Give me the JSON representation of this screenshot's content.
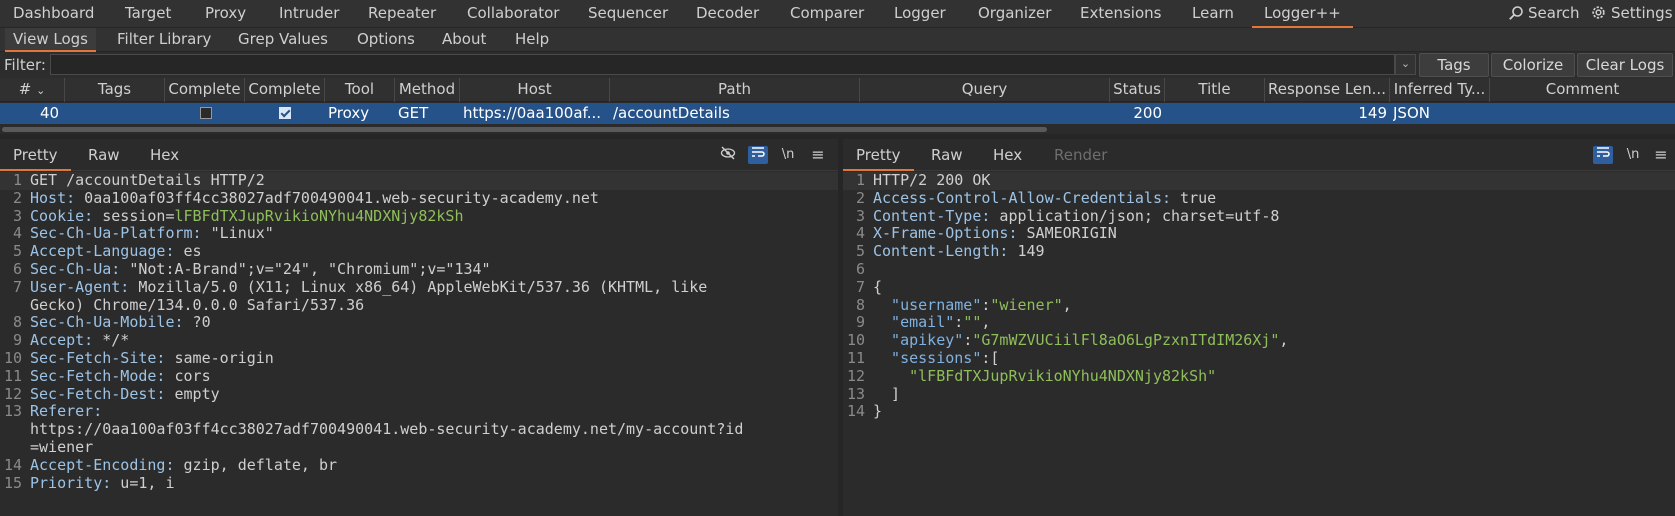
{
  "menu": {
    "tabs": [
      "Dashboard",
      "Target",
      "Proxy",
      "Intruder",
      "Repeater",
      "Collaborator",
      "Sequencer",
      "Decoder",
      "Comparer",
      "Logger",
      "Organizer",
      "Extensions",
      "Learn",
      "Logger++"
    ],
    "search_label": "Search",
    "settings_label": "Settings"
  },
  "subtabs": [
    "View Logs",
    "Filter Library",
    "Grep Values",
    "Options",
    "About",
    "Help"
  ],
  "filter": {
    "label": "Filter:",
    "value": "",
    "tags_button": "Tags",
    "colorize_button": "Colorize",
    "clear_button": "Clear Logs"
  },
  "table": {
    "headers": [
      "#",
      "Tags",
      "Complete",
      "Complete",
      "Tool",
      "Method",
      "Host",
      "Path",
      "Query",
      "Status",
      "Title",
      "Response Len...",
      "Inferred Ty...",
      "Comment"
    ],
    "row": {
      "num": "40",
      "tags": "",
      "complete1": false,
      "complete2": true,
      "tool": "Proxy",
      "method": "GET",
      "host": "https://0aa100af...",
      "path": "/accountDetails",
      "query": "",
      "status": "200",
      "title": "",
      "response_length": "149",
      "inferred_type": "JSON",
      "comment": ""
    }
  },
  "request": {
    "tabs": [
      "Pretty",
      "Raw",
      "Hex"
    ],
    "lines": [
      {
        "n": "1",
        "k": "",
        "v": "GET /accountDetails HTTP/2"
      },
      {
        "n": "2",
        "k": "Host:",
        "v": " 0aa100af03ff4cc38027adf700490041.web-security-academy.net"
      },
      {
        "n": "3",
        "k": "Cookie:",
        "v": " session=",
        "c": "lFBFdTXJupRvikioNYhu4NDXNjy82kSh"
      },
      {
        "n": "4",
        "k": "Sec-Ch-Ua-Platform:",
        "v": " \"Linux\""
      },
      {
        "n": "5",
        "k": "Accept-Language:",
        "v": " es"
      },
      {
        "n": "6",
        "k": "Sec-Ch-Ua:",
        "v": " \"Not:A-Brand\";v=\"24\", \"Chromium\";v=\"134\""
      },
      {
        "n": "7",
        "k": "User-Agent:",
        "v": " Mozilla/5.0 (X11; Linux x86_64) AppleWebKit/537.36 (KHTML, like"
      },
      {
        "n": "",
        "k": "",
        "v": "Gecko) Chrome/134.0.0.0 Safari/537.36"
      },
      {
        "n": "8",
        "k": "Sec-Ch-Ua-Mobile:",
        "v": " ?0"
      },
      {
        "n": "9",
        "k": "Accept:",
        "v": " */*"
      },
      {
        "n": "10",
        "k": "Sec-Fetch-Site:",
        "v": " same-origin"
      },
      {
        "n": "11",
        "k": "Sec-Fetch-Mode:",
        "v": " cors"
      },
      {
        "n": "12",
        "k": "Sec-Fetch-Dest:",
        "v": " empty"
      },
      {
        "n": "13",
        "k": "Referer:",
        "v": ""
      },
      {
        "n": "",
        "k": "",
        "v": "https://0aa100af03ff4cc38027adf700490041.web-security-academy.net/my-account?id"
      },
      {
        "n": "",
        "k": "",
        "v": "=wiener"
      },
      {
        "n": "14",
        "k": "Accept-Encoding:",
        "v": " gzip, deflate, br"
      },
      {
        "n": "15",
        "k": "Priority:",
        "v": " u=1, i"
      }
    ]
  },
  "response": {
    "tabs": [
      "Pretty",
      "Raw",
      "Hex",
      "Render"
    ],
    "lines": [
      {
        "n": "1",
        "k": "",
        "v": "HTTP/2 200 OK"
      },
      {
        "n": "2",
        "k": "Access-Control-Allow-Credentials:",
        "v": " true"
      },
      {
        "n": "3",
        "k": "Content-Type:",
        "v": " application/json; charset=utf-8"
      },
      {
        "n": "4",
        "k": "X-Frame-Options:",
        "v": " SAMEORIGIN"
      },
      {
        "n": "5",
        "k": "Content-Length:",
        "v": " 149"
      },
      {
        "n": "6",
        "k": "",
        "v": ""
      },
      {
        "n": "7",
        "k": "",
        "v": "{"
      },
      {
        "n": "8",
        "jk": "  \"username\"",
        "p": ":",
        "js": "\"wiener\"",
        "e": ","
      },
      {
        "n": "9",
        "jk": "  \"email\"",
        "p": ":",
        "js": "\"\"",
        "e": ","
      },
      {
        "n": "10",
        "jk": "  \"apikey\"",
        "p": ":",
        "js": "\"G7mWZVUCiilFl8aO6LgPzxnITdIM26Xj\"",
        "e": ","
      },
      {
        "n": "11",
        "jk": "  \"sessions\"",
        "p": ":[",
        "js": "",
        "e": ""
      },
      {
        "n": "12",
        "jk": "",
        "p": "    ",
        "js": "\"lFBFdTXJupRvikioNYhu4NDXNjy82kSh\"",
        "e": ""
      },
      {
        "n": "13",
        "k": "",
        "v": "  ]"
      },
      {
        "n": "14",
        "k": "",
        "v": "}"
      }
    ]
  },
  "icons": {
    "search": "search-icon",
    "settings": "gear-icon",
    "hide": "eye-off-icon",
    "wrap": "wrap-icon",
    "newline": "newline-icon",
    "menu": "hamburger-icon"
  },
  "colors": {
    "accent": "#e0763a",
    "selection": "#255289",
    "cookie": "#8fbf5a",
    "json_key": "#7fb2e0"
  }
}
